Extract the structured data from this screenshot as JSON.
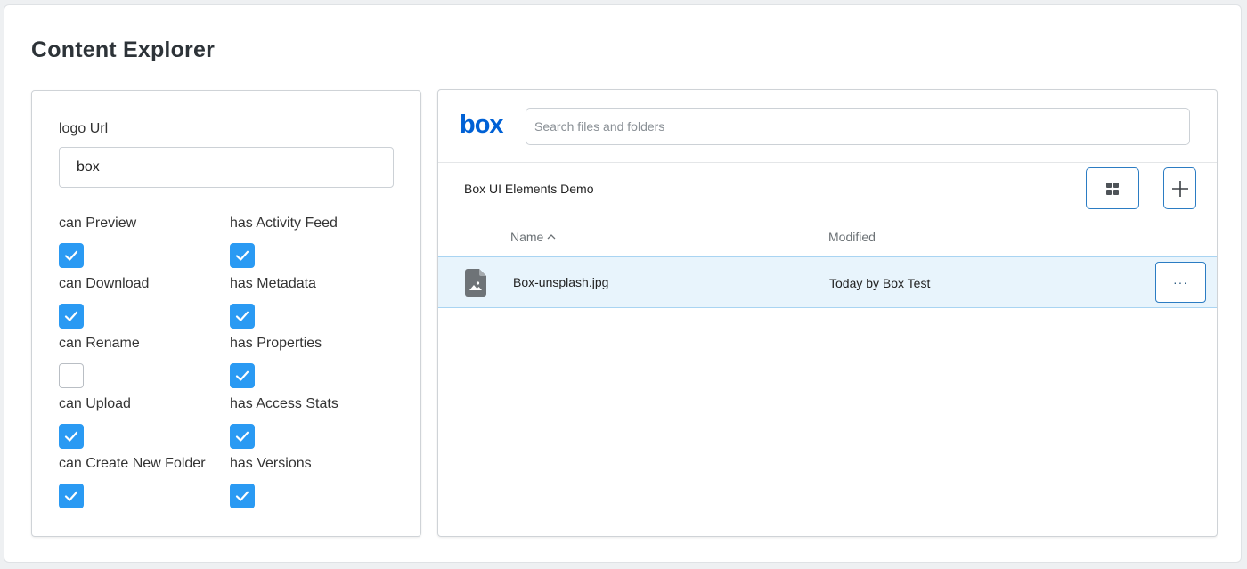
{
  "page_title": "Content Explorer",
  "settings": {
    "logo_label": "logo Url",
    "logo_value": "box",
    "options": [
      {
        "label": "can Preview",
        "checked": true
      },
      {
        "label": "has Activity Feed",
        "checked": true
      },
      {
        "label": "can Download",
        "checked": true
      },
      {
        "label": "has Metadata",
        "checked": true
      },
      {
        "label": "can Rename",
        "checked": false
      },
      {
        "label": "has Properties",
        "checked": true
      },
      {
        "label": "can Upload",
        "checked": true
      },
      {
        "label": "has Access Stats",
        "checked": true
      },
      {
        "label": "can Create New Folder",
        "checked": true
      },
      {
        "label": "has Versions",
        "checked": true
      }
    ]
  },
  "explorer": {
    "logo": "box",
    "search_placeholder": "Search files and folders",
    "folder_name": "Box UI Elements Demo",
    "columns": {
      "name": "Name",
      "modified": "Modified"
    },
    "sort_indicator": "^",
    "files": [
      {
        "name": "Box-unsplash.jpg",
        "modified": "Today by Box Test",
        "more_label": "···"
      }
    ]
  },
  "colors": {
    "accent": "#2a9af3",
    "button_border": "#2b7cc3",
    "row_selected": "#e8f4fc",
    "box_brand": "#0061d5"
  },
  "icons": {
    "grid_view": "grid-icon",
    "add": "plus-icon",
    "file": "image-file-icon",
    "check": "checkmark-icon",
    "more": "ellipsis-icon",
    "sort": "sort-ascending-icon"
  }
}
